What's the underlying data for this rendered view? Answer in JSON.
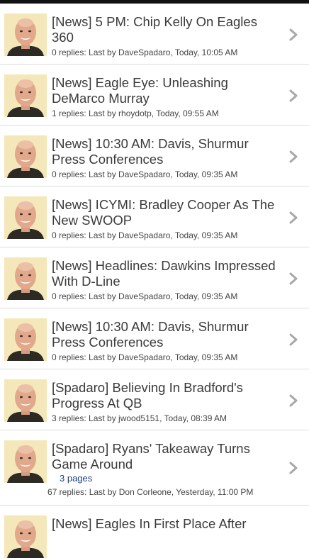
{
  "threads": [
    {
      "title": "[News] 5 PM: Chip Kelly On Eagles 360",
      "meta": "0 replies: Last by DaveSpadaro, Today, 10:05 AM"
    },
    {
      "title": "[News] Eagle Eye: Unleashing DeMarco Murray",
      "meta": "1 replies: Last by rhoydotp, Today, 09:55 AM"
    },
    {
      "title": "[News] 10:30 AM: Davis, Shurmur Press Conferences",
      "meta": "0 replies: Last by DaveSpadaro, Today, 09:35 AM"
    },
    {
      "title": "[News] ICYMI: Bradley Cooper As The New SWOOP",
      "meta": "0 replies: Last by DaveSpadaro, Today, 09:35 AM"
    },
    {
      "title": "[News] Headlines: Dawkins Impressed With D-Line",
      "meta": "0 replies: Last by DaveSpadaro, Today, 09:35 AM"
    },
    {
      "title": "[News] 10:30 AM: Davis, Shurmur Press Conferences",
      "meta": "0 replies: Last by DaveSpadaro, Today, 09:35 AM"
    },
    {
      "title": "[Spadaro] Believing In Bradford's Progress At QB",
      "meta": "3 replies: Last by jwood5151, Today, 08:39 AM"
    },
    {
      "title": "[Spadaro] Ryans' Takeaway Turns Game Around",
      "pages": "3 pages",
      "meta": "67 replies: Last by Don Corleone, Yesterday, 11:00 PM"
    },
    {
      "title": "[News] Eagles In First Place After"
    }
  ],
  "icons": {
    "avatar": "user-avatar",
    "chevron": "chevron-right-icon"
  },
  "colors": {
    "title": "#3b3b3b",
    "meta": "#444444",
    "pages_link": "#1f3f79",
    "chevron": "#a8a8a8",
    "divider": "#dcdcdc"
  }
}
